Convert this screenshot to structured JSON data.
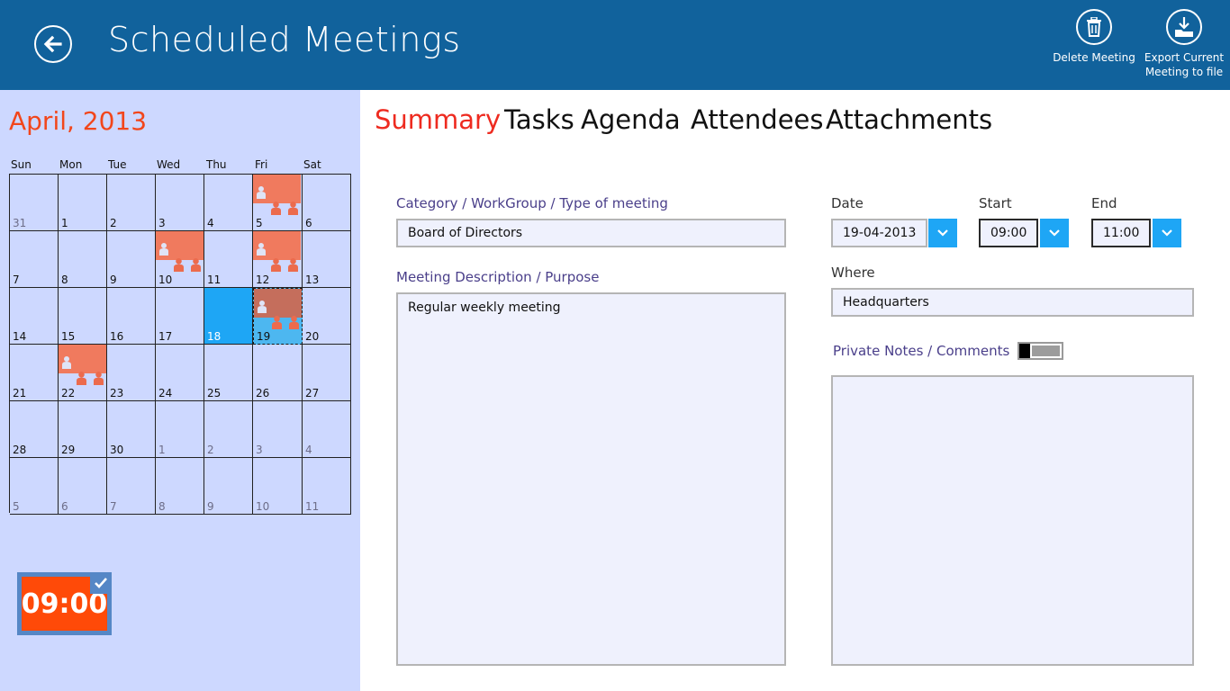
{
  "header": {
    "title": "Scheduled Meetings",
    "actions": [
      {
        "label": "Delete Meeting",
        "icon": "trash-icon"
      },
      {
        "label_line1": "Export Current",
        "label_line2": "Meeting to file",
        "icon": "download-icon"
      }
    ]
  },
  "calendar": {
    "month_title": "April, 2013",
    "weekdays": [
      "Sun",
      "Mon",
      "Tue",
      "Wed",
      "Thu",
      "Fri",
      "Sat"
    ],
    "weeks": [
      [
        "31",
        "1",
        "2",
        "3",
        "4",
        "5",
        "6"
      ],
      [
        "7",
        "8",
        "9",
        "10",
        "11",
        "12",
        "13"
      ],
      [
        "14",
        "15",
        "16",
        "17",
        "18",
        "19",
        "20"
      ],
      [
        "21",
        "22",
        "23",
        "24",
        "25",
        "26",
        "27"
      ],
      [
        "28",
        "29",
        "30",
        "1",
        "2",
        "3",
        "4"
      ],
      [
        "5",
        "6",
        "7",
        "8",
        "9",
        "10",
        "11"
      ]
    ],
    "today": "18",
    "selected": "19",
    "meeting_days": [
      "5",
      "10",
      "12",
      "19",
      "22"
    ]
  },
  "time_tile": {
    "time": "09:00"
  },
  "tabs": [
    "Summary",
    "Tasks",
    "Agenda",
    "Attendees",
    "Attachments"
  ],
  "active_tab": "Summary",
  "form": {
    "category_label": "Category / WorkGroup / Type of meeting",
    "category_value": "Board of Directors",
    "description_label": "Meeting Description / Purpose",
    "description_value": "Regular weekly meeting",
    "date_label": "Date",
    "date_value": "19-04-2013",
    "start_label": "Start",
    "start_value": "09:00",
    "end_label": "End",
    "end_value": "11:00",
    "where_label": "Where",
    "where_value": "Headquarters",
    "notes_label": "Private Notes / Comments",
    "notes_value": ""
  },
  "colors": {
    "header": "#11629c",
    "calendar_bg": "#cdd8ff",
    "accent_red": "#ee2b20",
    "accent_blue": "#1ea6f5",
    "meeting_block": "#f07a5e",
    "time_tile": "#ff4a08"
  }
}
